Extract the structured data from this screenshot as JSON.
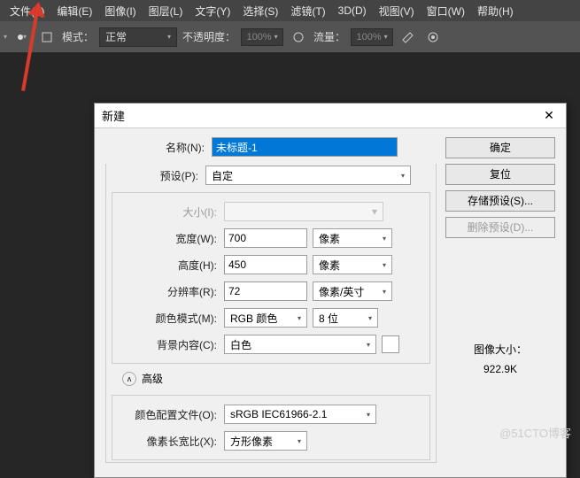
{
  "menu": {
    "file": "文件(F)",
    "edit": "编辑(E)",
    "image": "图像(I)",
    "layer": "图层(L)",
    "type": "文字(Y)",
    "select": "选择(S)",
    "filter": "滤镜(T)",
    "3d": "3D(D)",
    "view": "视图(V)",
    "window": "窗口(W)",
    "help": "帮助(H)"
  },
  "toolbar": {
    "mode_label": "模式：",
    "mode_value": "正常",
    "opacity_label": "不透明度：",
    "opacity_value": "100%",
    "flow_label": "流量：",
    "flow_value": "100%"
  },
  "dialog": {
    "title": "新建",
    "name_label": "名称(N):",
    "name_value": "未标题-1",
    "preset_label": "预设(P):",
    "preset_value": "自定",
    "size_label": "大小(I):",
    "size_value": "",
    "width_label": "宽度(W):",
    "width_value": "700",
    "width_unit": "像素",
    "height_label": "高度(H):",
    "height_value": "450",
    "height_unit": "像素",
    "res_label": "分辨率(R):",
    "res_value": "72",
    "res_unit": "像素/英寸",
    "cmode_label": "颜色模式(M):",
    "cmode_value": "RGB 颜色",
    "cbit_value": "8 位",
    "bg_label": "背景内容(C):",
    "bg_value": "白色",
    "adv_label": "高级",
    "profile_label": "颜色配置文件(O):",
    "profile_value": "sRGB IEC61966-2.1",
    "aspect_label": "像素长宽比(X):",
    "aspect_value": "方形像素",
    "ok": "确定",
    "reset": "复位",
    "save_preset": "存储预设(S)...",
    "del_preset": "删除预设(D)...",
    "imgsize_label": "图像大小：",
    "imgsize_value": "922.9K"
  },
  "watermark": "@51CTO博客"
}
